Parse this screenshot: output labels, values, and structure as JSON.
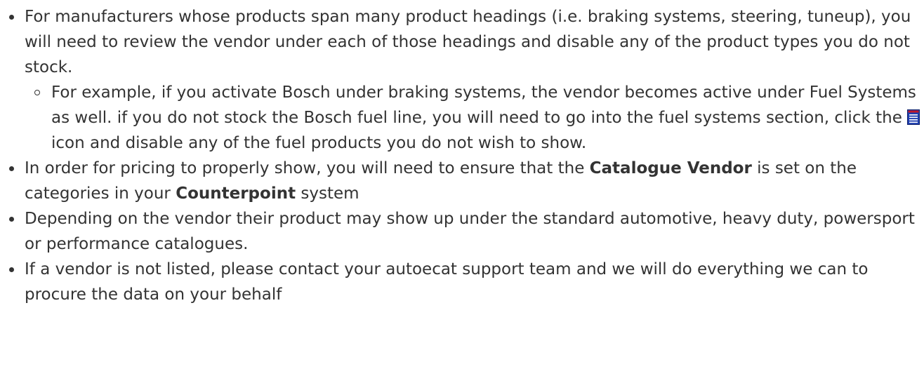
{
  "bullets": [
    {
      "text": "For manufacturers whose products span many product headings (i.e. braking systems, steering, tuneup), you will need to review the vendor under each of those headings and disable any of the product types you do not stock.",
      "sub": [
        {
          "before_icon": "For example, if you activate Bosch under braking systems, the vendor becomes active under Fuel Systems as well. if you do not stock the Bosch fuel line, you will need to go into the fuel systems section, click the ",
          "icon": "list-icon",
          "after_icon": " icon and disable any of the fuel products you do not wish to show."
        }
      ]
    },
    {
      "part1": "In order for pricing to properly show, you will need to ensure that the ",
      "bold1": "Catalogue Vendor",
      "part2": " is set on the categories in your ",
      "bold2": "Counterpoint",
      "part3": " system"
    },
    {
      "text": "Depending on the vendor their product may show up under the standard automotive, heavy duty, powersport or performance catalogues."
    },
    {
      "text": "If a vendor is not listed, please contact your autoecat support team and we will do everything we can to procure the data on your behalf"
    }
  ],
  "colors": {
    "text": "#333333",
    "icon_blue": "#1f3fb0",
    "icon_red": "#c0182a"
  }
}
